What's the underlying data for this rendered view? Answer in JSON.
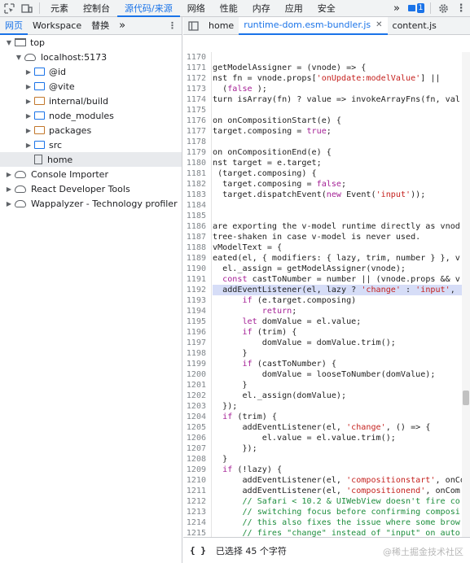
{
  "topbar": {
    "tabs": [
      "元素",
      "控制台",
      "源代码/来源",
      "网络",
      "性能",
      "内存",
      "应用",
      "安全"
    ],
    "active_tab_index": 2,
    "more": "»",
    "issues_count": "1"
  },
  "navigator": {
    "tabs": [
      "网页",
      "Workspace",
      "替换"
    ],
    "more": "»",
    "tree": [
      {
        "label": "top",
        "depth": 0,
        "icon": "window",
        "expanded": true
      },
      {
        "label": "localhost:5173",
        "depth": 1,
        "icon": "cloud",
        "expanded": true
      },
      {
        "label": "@id",
        "depth": 2,
        "icon": "folder-blue",
        "expanded": false
      },
      {
        "label": "@vite",
        "depth": 2,
        "icon": "folder-blue",
        "expanded": false
      },
      {
        "label": "internal/build",
        "depth": 2,
        "icon": "folder-orange",
        "expanded": false
      },
      {
        "label": "node_modules",
        "depth": 2,
        "icon": "folder-blue",
        "expanded": false
      },
      {
        "label": "packages",
        "depth": 2,
        "icon": "folder-orange",
        "expanded": false
      },
      {
        "label": "src",
        "depth": 2,
        "icon": "folder-blue",
        "expanded": false
      },
      {
        "label": "home",
        "depth": 2,
        "icon": "file",
        "selected": true
      },
      {
        "label": "Console Importer",
        "depth": 0,
        "icon": "cloud",
        "expanded": false
      },
      {
        "label": "React Developer Tools",
        "depth": 0,
        "icon": "cloud",
        "expanded": false
      },
      {
        "label": "Wappalyzer - Technology profiler",
        "depth": 0,
        "icon": "cloud",
        "expanded": false
      }
    ]
  },
  "editor": {
    "tabs": [
      {
        "label": "home",
        "active": false,
        "closable": false
      },
      {
        "label": "runtime-dom.esm-bundler.js",
        "active": true,
        "closable": true
      },
      {
        "label": "content.js",
        "active": false,
        "closable": false
      }
    ],
    "highlight_line": 1192,
    "lines": [
      {
        "n": "1170",
        "t": ""
      },
      {
        "n": "1171",
        "t": "getModelAssigner = (vnode) => {"
      },
      {
        "n": "1172",
        "t": "nst fn = vnode.props['onUpdate:modelValue'] ||"
      },
      {
        "n": "1173",
        "t": "  (false );"
      },
      {
        "n": "1174",
        "t": "turn isArray(fn) ? value => invokeArrayFns(fn, val"
      },
      {
        "n": "1175",
        "t": ""
      },
      {
        "n": "1176",
        "t": "on onCompositionStart(e) {"
      },
      {
        "n": "1177",
        "t": "target.composing = true;"
      },
      {
        "n": "1178",
        "t": ""
      },
      {
        "n": "1179",
        "t": "on onCompositionEnd(e) {"
      },
      {
        "n": "1180",
        "t": "nst target = e.target;"
      },
      {
        "n": "1181",
        "t": " (target.composing) {"
      },
      {
        "n": "1182",
        "t": "  target.composing = false;"
      },
      {
        "n": "1183",
        "t": "  target.dispatchEvent(new Event('input'));"
      },
      {
        "n": "1184",
        "t": ""
      },
      {
        "n": "1185",
        "t": ""
      },
      {
        "n": "1186",
        "t": "are exporting the v-model runtime directly as vnod"
      },
      {
        "n": "1187",
        "t": "tree-shaken in case v-model is never used."
      },
      {
        "n": "1188",
        "t": "vModelText = {"
      },
      {
        "n": "1189",
        "t": "eated(el, { modifiers: { lazy, trim, number } }, v"
      },
      {
        "n": "1190",
        "t": "  el._assign = getModelAssigner(vnode);"
      },
      {
        "n": "1191",
        "t": "  const castToNumber = number || (vnode.props && v"
      },
      {
        "n": "1192",
        "t": "  addEventListener(el, lazy ? 'change' : 'input',"
      },
      {
        "n": "1193",
        "t": "      if (e.target.composing)"
      },
      {
        "n": "1194",
        "t": "          return;"
      },
      {
        "n": "1195",
        "t": "      let domValue = el.value;"
      },
      {
        "n": "1196",
        "t": "      if (trim) {"
      },
      {
        "n": "1197",
        "t": "          domValue = domValue.trim();"
      },
      {
        "n": "1198",
        "t": "      }"
      },
      {
        "n": "1199",
        "t": "      if (castToNumber) {"
      },
      {
        "n": "1200",
        "t": "          domValue = looseToNumber(domValue);"
      },
      {
        "n": "1201",
        "t": "      }"
      },
      {
        "n": "1202",
        "t": "      el._assign(domValue);"
      },
      {
        "n": "1203",
        "t": "  });"
      },
      {
        "n": "1204",
        "t": "  if (trim) {"
      },
      {
        "n": "1205",
        "t": "      addEventListener(el, 'change', () => {"
      },
      {
        "n": "1206",
        "t": "          el.value = el.value.trim();"
      },
      {
        "n": "1207",
        "t": "      });"
      },
      {
        "n": "1208",
        "t": "  }"
      },
      {
        "n": "1209",
        "t": "  if (!lazy) {"
      },
      {
        "n": "1210",
        "t": "      addEventListener(el, 'compositionstart', onCo"
      },
      {
        "n": "1211",
        "t": "      addEventListener(el, 'compositionend', onCom"
      },
      {
        "n": "1212",
        "t": "      // Safari < 10.2 & UIWebView doesn't fire co"
      },
      {
        "n": "1213",
        "t": "      // switching focus before confirming composi"
      },
      {
        "n": "1214",
        "t": "      // this also fixes the issue where some brow"
      },
      {
        "n": "1215",
        "t": "      // fires \"change\" instead of \"input\" on auto"
      }
    ]
  },
  "status": {
    "braces": "{ }",
    "selection": "已选择 45 个字符"
  },
  "watermark": "@稀土掘金技术社区"
}
